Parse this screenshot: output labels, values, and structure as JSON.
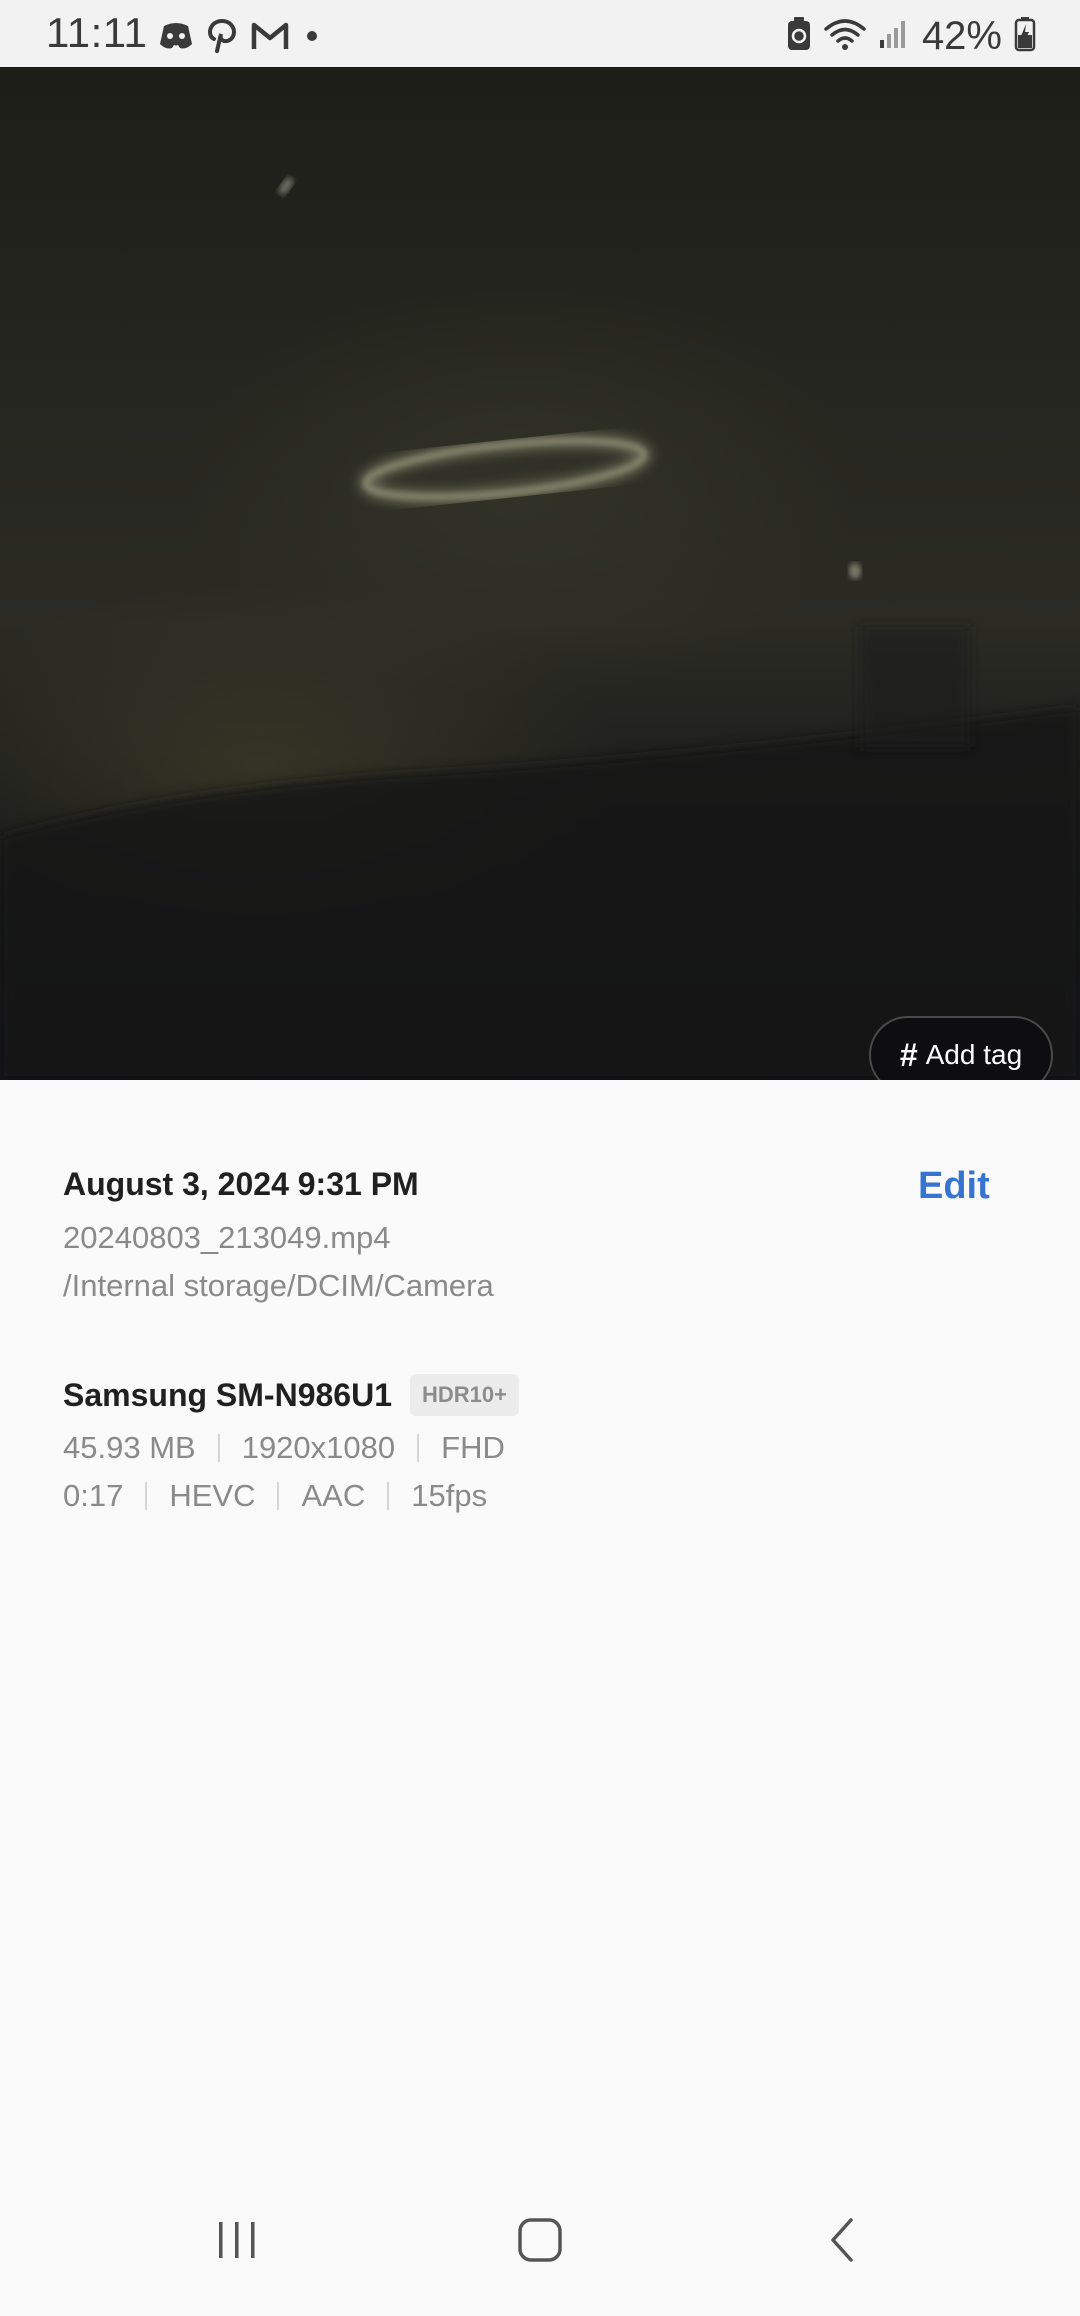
{
  "status_bar": {
    "time": "11:11",
    "battery_percent": "42%",
    "left_icons": [
      "discord-icon",
      "pinterest-icon",
      "gmail-icon",
      "notification-dot-icon"
    ],
    "right_icons": [
      "battery-saver-icon",
      "wifi-icon",
      "signal-icon",
      "battery-charging-icon"
    ]
  },
  "media": {
    "add_tag_hash": "#",
    "add_tag_label": "Add tag"
  },
  "details": {
    "date": "August 3, 2024 9:31 PM",
    "edit_label": "Edit",
    "filename": "20240803_213049.mp4",
    "path": "/Internal storage/DCIM/Camera",
    "device": "Samsung SM-N986U1",
    "badge": "HDR10+",
    "meta_row1": [
      "45.93 MB",
      "1920x1080",
      "FHD"
    ],
    "meta_row2": [
      "0:17",
      "HEVC",
      "AAC",
      "15fps"
    ]
  },
  "nav": {
    "buttons": [
      "recents-icon",
      "home-icon",
      "back-icon"
    ]
  },
  "colors": {
    "accent": "#3774d2",
    "status_bar_bg": "#f2f2f2",
    "panel_bg": "#fafafa"
  }
}
